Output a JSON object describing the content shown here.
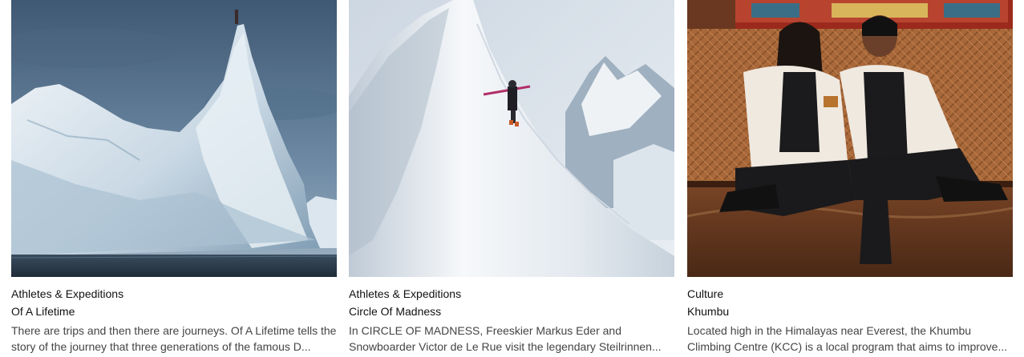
{
  "cards": [
    {
      "category": "Athletes & Expeditions",
      "title": "Of A Lifetime",
      "description": "There are trips and then there are journeys. Of A Lifetime tells the story of the journey that three generations of the famous D...",
      "image": "iceberg-photo"
    },
    {
      "category": "Athletes & Expeditions",
      "title": "Circle Of Madness",
      "description": "In CIRCLE OF MADNESS, Freeskier Markus Eder and Snowboarder Victor de Le Rue visit the legendary Steilrinnen...",
      "image": "snow-ridge-photo"
    },
    {
      "category": "Culture",
      "title": "Khumbu",
      "description": "Located high in the Himalayas near Everest, the Khumbu Climbing Centre (KCC) is a local program that aims to improve...",
      "image": "portrait-photo"
    }
  ]
}
